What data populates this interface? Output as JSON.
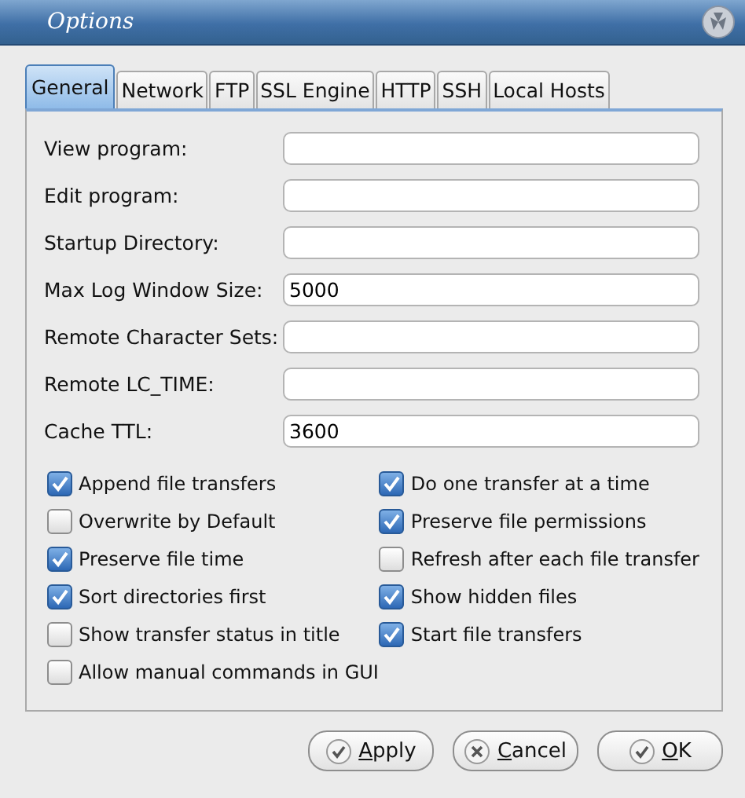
{
  "window": {
    "title": "Options"
  },
  "tabs": [
    {
      "label": "General",
      "selected": true
    },
    {
      "label": "Network",
      "selected": false
    },
    {
      "label": "FTP",
      "selected": false
    },
    {
      "label": "SSL Engine",
      "selected": false
    },
    {
      "label": "HTTP",
      "selected": false
    },
    {
      "label": "SSH",
      "selected": false
    },
    {
      "label": "Local Hosts",
      "selected": false
    }
  ],
  "fields": [
    {
      "label": "View program:"
    },
    {
      "label": "Edit program:"
    },
    {
      "label": "Startup Directory:"
    },
    {
      "label": "Max Log Window Size:",
      "value": "5000"
    },
    {
      "label": "Remote Character Sets:"
    },
    {
      "label": "Remote LC_TIME:"
    },
    {
      "label": "Cache TTL:",
      "value": "3600"
    }
  ],
  "checkboxes_left": [
    {
      "label": "Append file transfers",
      "checked": true
    },
    {
      "label": "Overwrite by Default",
      "checked": false
    },
    {
      "label": "Preserve file time",
      "checked": true
    },
    {
      "label": "Sort directories first",
      "checked": true
    },
    {
      "label": "Show transfer status in title",
      "checked": false
    },
    {
      "label": "Allow manual commands in GUI",
      "checked": false
    }
  ],
  "checkboxes_right": [
    {
      "label": "Do one transfer at a time",
      "checked": true
    },
    {
      "label": "Preserve file permissions",
      "checked": true
    },
    {
      "label": "Refresh after each file transfer",
      "checked": false
    },
    {
      "label": "Show hidden files",
      "checked": true
    },
    {
      "label": "Start file transfers",
      "checked": true
    }
  ],
  "buttons": [
    {
      "kind": "check",
      "mnemonic": "A",
      "rest": "pply"
    },
    {
      "kind": "cross",
      "mnemonic": "C",
      "rest": "ancel"
    },
    {
      "kind": "check",
      "mnemonic": "O",
      "rest": "K"
    }
  ]
}
